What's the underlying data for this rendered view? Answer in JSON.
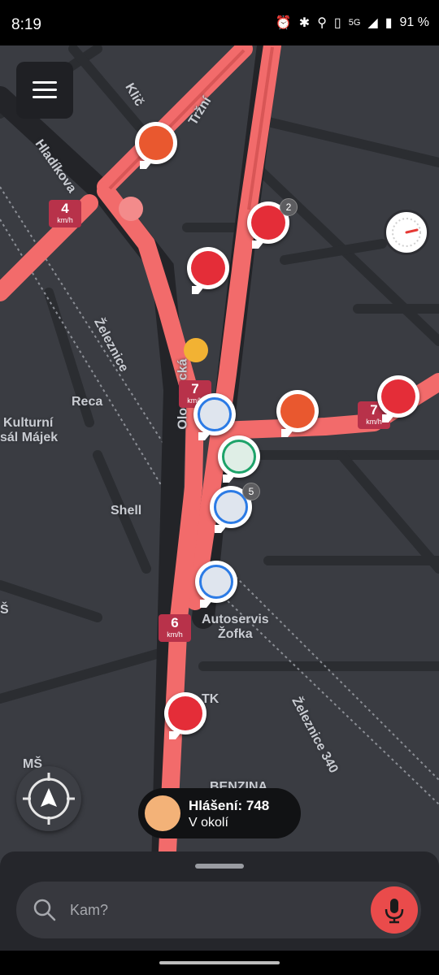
{
  "status_bar": {
    "time": "8:19",
    "network": "5G",
    "battery": "91 %"
  },
  "map": {
    "street_labels": [
      "Tržní",
      "Klič",
      "Hladíkova",
      "Železnice",
      "Reca",
      "Kulturní",
      "sál Májek",
      "Shell",
      "Autoservis",
      "Žofka",
      "TK",
      "Železnice 340",
      "MŠ",
      "Š",
      "BENZINA",
      "Olomoucká"
    ],
    "speed_markers": [
      {
        "value": "4",
        "unit": "km/h"
      },
      {
        "value": "7",
        "unit": "km/h"
      },
      {
        "value": "7",
        "unit": "km/h"
      },
      {
        "value": "6",
        "unit": "km/h"
      }
    ],
    "report_pins": [
      {
        "type": "traffic-jam",
        "color": "#e9582f",
        "count": ""
      },
      {
        "type": "traffic-jam",
        "color": "#e42d38",
        "count": "2"
      },
      {
        "type": "traffic-jam",
        "color": "#e42d38",
        "count": ""
      },
      {
        "type": "traffic-jam",
        "color": "#e9582f",
        "count": ""
      },
      {
        "type": "traffic-jam",
        "color": "#e42d38",
        "count": ""
      },
      {
        "type": "crash",
        "color": "#2c7be5",
        "count": ""
      },
      {
        "type": "crash",
        "color": "#1ea36a",
        "count": ""
      },
      {
        "type": "crash",
        "color": "#2c7be5",
        "count": "5"
      },
      {
        "type": "crash",
        "color": "#2c7be5",
        "count": ""
      },
      {
        "type": "traffic-jam",
        "color": "#e42d38",
        "count": ""
      }
    ],
    "road_color": "#f26b6b",
    "base_color": "#3a3c42"
  },
  "reports_bubble": {
    "title": "Hlášení: 748",
    "subtitle": "V okolí"
  },
  "search": {
    "placeholder": "Kam?"
  },
  "colors": {
    "accent": "#ea4b4b",
    "panel": "#25262b"
  }
}
